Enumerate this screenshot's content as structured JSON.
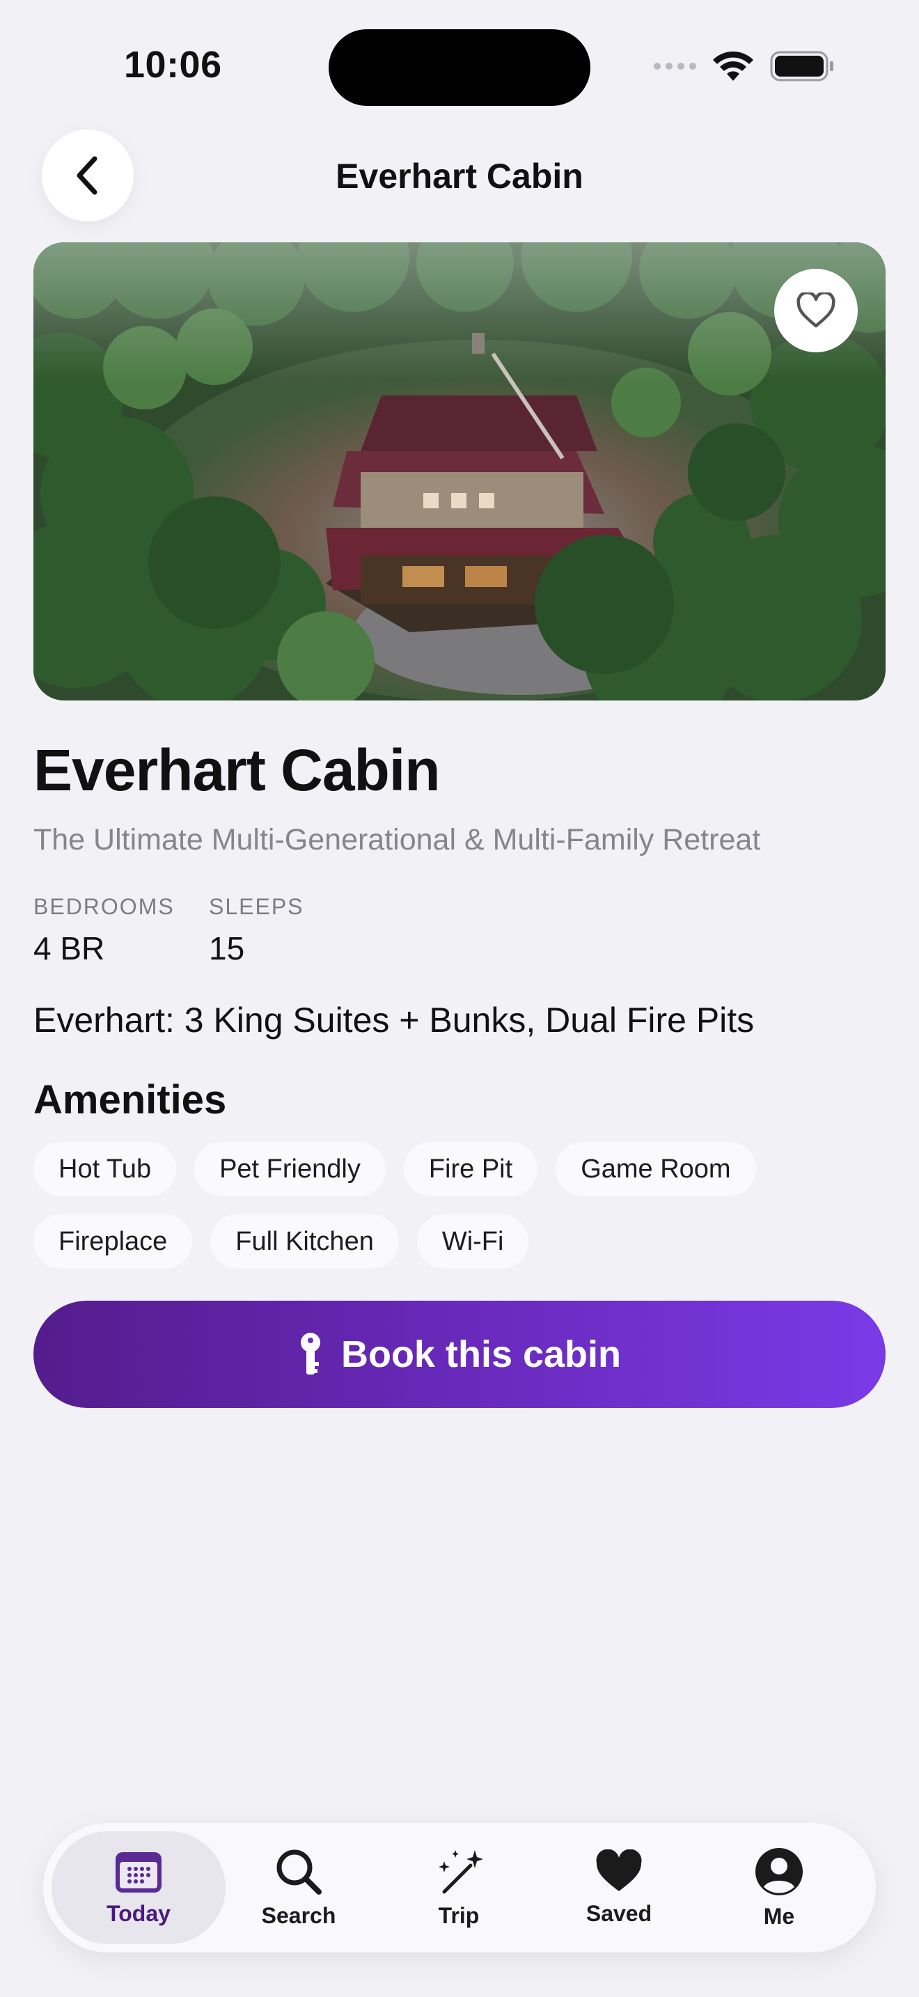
{
  "status_bar": {
    "time": "10:06"
  },
  "header": {
    "title": "Everhart Cabin"
  },
  "listing": {
    "name": "Everhart Cabin",
    "tagline": "The Ultimate Multi-Generational & Multi-Family Retreat",
    "stats": [
      {
        "label": "BEDROOMS",
        "value": "4 BR"
      },
      {
        "label": "SLEEPS",
        "value": "15"
      }
    ],
    "headline": "Everhart: 3 King Suites + Bunks, Dual Fire Pits"
  },
  "amenities": {
    "title": "Amenities",
    "items": [
      "Hot Tub",
      "Pet Friendly",
      "Fire Pit",
      "Game Room",
      "Fireplace",
      "Full Kitchen",
      "Wi-Fi"
    ]
  },
  "book_button": {
    "label": "Book this cabin",
    "icon": "key-icon"
  },
  "tabbar": {
    "active": "Today",
    "tabs": [
      {
        "label": "Today",
        "icon": "calendar-icon"
      },
      {
        "label": "Search",
        "icon": "search-icon"
      },
      {
        "label": "Trip",
        "icon": "magic-wand-icon"
      },
      {
        "label": "Saved",
        "icon": "heart-icon"
      },
      {
        "label": "Me",
        "icon": "person-icon"
      }
    ]
  },
  "colors": {
    "accent": "#6a2bbf",
    "accent_dark": "#541c8c",
    "background": "#f2f1f6"
  }
}
